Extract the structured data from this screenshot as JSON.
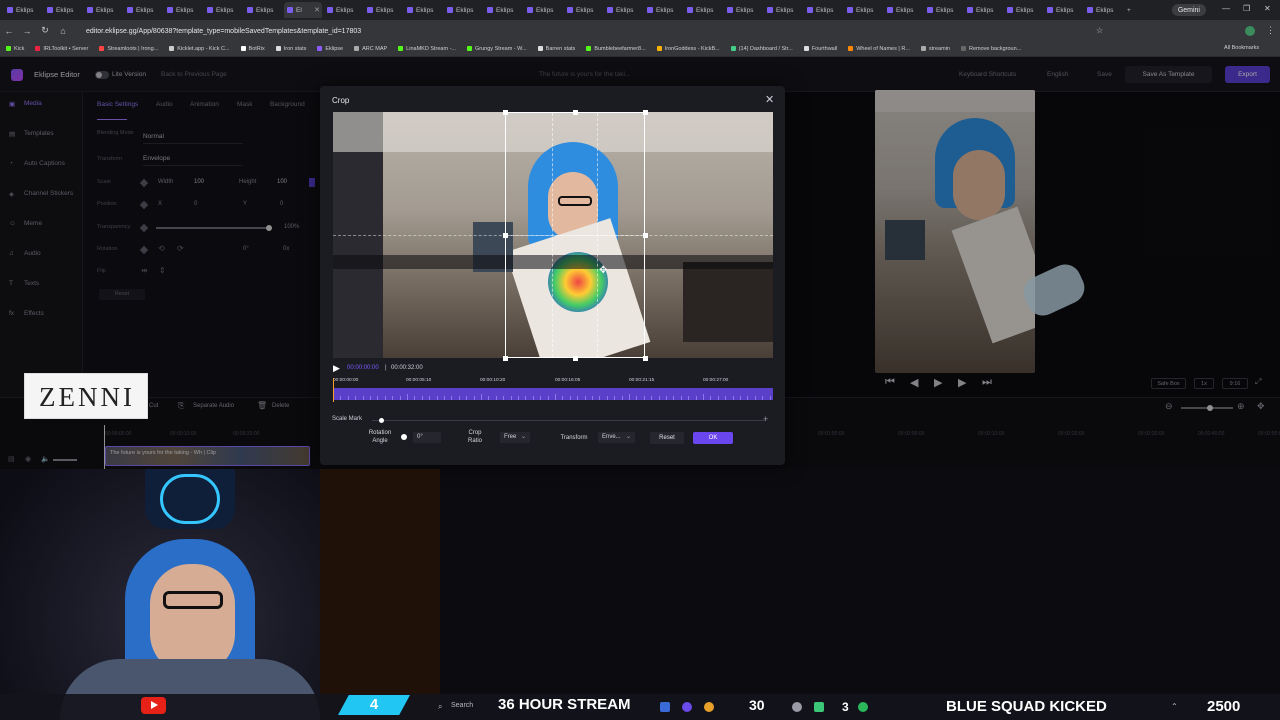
{
  "browser": {
    "tabs": [
      "Eklips",
      "Eklips",
      "Eklips",
      "Eklips",
      "Eklips",
      "Eklips",
      "Eklips",
      "El",
      "Eklips",
      "Eklips",
      "Eklips",
      "Eklips",
      "Eklips",
      "Eklips",
      "Eklips",
      "Eklips",
      "Eklips",
      "Eklips",
      "Eklips",
      "Eklips",
      "Eklips",
      "Eklips",
      "Eklips",
      "Eklips",
      "Eklips",
      "Eklips",
      "Eklips",
      "Eklips"
    ],
    "gemini": "Gemini",
    "url": "editor.eklipse.gg/App/80638?template_type=mobileSavedTemplates&template_id=17803",
    "bookmarks": [
      {
        "label": "Kick",
        "color": "#53fc18"
      },
      {
        "label": "IRLToolkit • Server",
        "color": "#e24"
      },
      {
        "label": "Streamloots | Irong...",
        "color": "#f44"
      },
      {
        "label": "Kicklet.app - Kick C...",
        "color": "#ccc"
      },
      {
        "label": "BotRix",
        "color": "#fff"
      },
      {
        "label": "Iron stats",
        "color": "#ddd"
      },
      {
        "label": "Eklipse",
        "color": "#8a5cff"
      },
      {
        "label": "ARC MAP",
        "color": "#aaa"
      },
      {
        "label": "LinaMKD Stream -...",
        "color": "#53fc18"
      },
      {
        "label": "Grungy Stream - W...",
        "color": "#53fc18"
      },
      {
        "label": "Barren stats",
        "color": "#ddd"
      },
      {
        "label": "Bumblebeefarmer8...",
        "color": "#53fc18"
      },
      {
        "label": "IronGoddess - KickB...",
        "color": "#ffb300"
      },
      {
        "label": "(14) Dashboard / Str...",
        "color": "#4c8"
      },
      {
        "label": "Fourthwall",
        "color": "#ddd"
      },
      {
        "label": "Wheel of Names | R...",
        "color": "#f80"
      },
      {
        "label": "streamin",
        "color": "#aaa"
      },
      {
        "label": "Remove backgroun...",
        "color": "#666"
      }
    ],
    "all_bookmarks": "All Bookmarks"
  },
  "app": {
    "name": "Eklipse Editor",
    "lite_version": "Lite Version",
    "back": "Back to Previous Page",
    "tagline": "The future is yours for the taki...",
    "shortcuts": "Keyboard Shortcuts",
    "language": "English",
    "save": "Save",
    "save_as_template": "Save As Template",
    "export": "Export"
  },
  "sidebar": [
    "Media",
    "Templates",
    "Auto Captions",
    "Channel Stickers",
    "Meme",
    "Audio",
    "Texts",
    "Effects"
  ],
  "props": {
    "tabs": [
      "Basic Settings",
      "Audio",
      "Animation",
      "Mask",
      "Background"
    ],
    "blending_label": "Blending Mode",
    "blending_value": "Normal",
    "transform_label": "Transform",
    "transform_value": "Envelope",
    "scale_label": "Scale",
    "width_label": "Width",
    "width_value": "100",
    "height_label": "Height",
    "height_value": "100",
    "position_label": "Position",
    "x_label": "X",
    "x_value": "0",
    "y_label": "Y",
    "y_value": "0",
    "transparency_label": "Transparency",
    "transparency_value": "100%",
    "rotation_label": "Rotation",
    "rotation_value": "0°",
    "rotation_value2": "0x",
    "flip_label": "Flip",
    "reset": "Reset"
  },
  "preview": {
    "safe_box": "Safe Box",
    "speed": "1x",
    "ratio": "9:16"
  },
  "timeline": {
    "cut": "Cut",
    "separate_audio": "Separate Audio",
    "delete": "Delete",
    "ticks": [
      "00:00:00:00",
      "00:00:10:00",
      "00:00:20:00",
      "00:01:50:00",
      "00:02:00:00",
      "00:02:10:00",
      "00:02:20:00",
      "00:02:30:00",
      "00:02:40:00",
      "00:02:50:00"
    ],
    "clip_label": "The future is yours for the taking - Wh | Clip"
  },
  "crop": {
    "title": "Crop",
    "current_time": "00:00:00:00",
    "total_time": "00:00:32:00",
    "ticks": [
      "00:00:00:00",
      "00:00:05:10",
      "00:00:10:20",
      "00:00:16:05",
      "00:00:21:15",
      "00:00:27:00"
    ],
    "scale_mark": "Scale Mark",
    "rotation_label": "Rotation Angle",
    "rotation_value": "0°",
    "crop_ratio_label": "Crop Ratio",
    "crop_ratio_value": "Free",
    "transform_label": "Transform",
    "transform_value": "Enve...",
    "reset": "Reset",
    "ok": "OK"
  },
  "overlay": {
    "zenni": "ZENNI",
    "badge_count": "4",
    "search": "Search",
    "stream_title": "36 HOUR STREAM",
    "count_30": "30",
    "count_3": "3",
    "squad": "BLUE SQUAD KICKED",
    "count_2500": "2500"
  }
}
